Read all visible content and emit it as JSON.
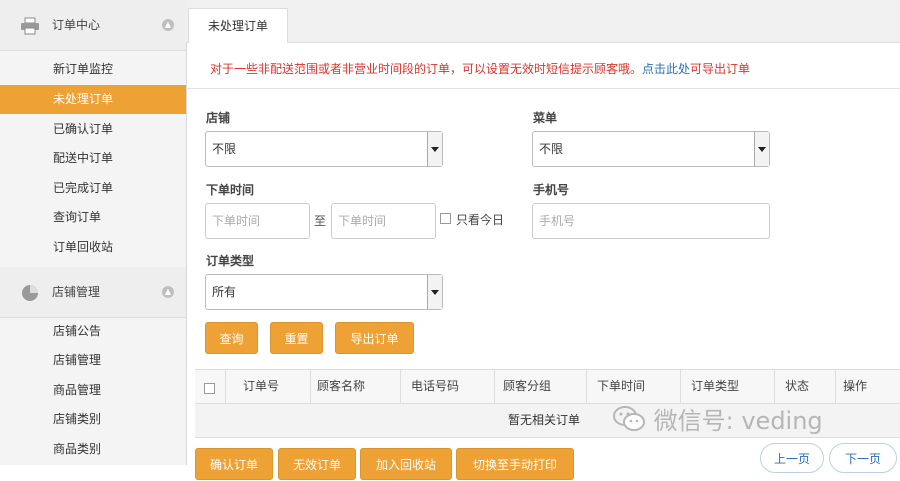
{
  "sidebar": {
    "sections": [
      {
        "label": "订单中心",
        "icon": "printer-icon",
        "toggle_icon": "collapse-up-icon",
        "items": [
          "新订单监控",
          "未处理订单",
          "已确认订单",
          "配送中订单",
          "已完成订单",
          "查询订单",
          "订单回收站"
        ],
        "active_index": 1
      },
      {
        "label": "店铺管理",
        "icon": "pie-chart-icon",
        "toggle_icon": "collapse-up-icon",
        "items": [
          "店铺公告",
          "店铺管理",
          "商品管理",
          "店铺类别",
          "商品类别"
        ]
      }
    ]
  },
  "tabs": [
    {
      "label": "未处理订单",
      "active": true
    }
  ],
  "notice": {
    "text_before": "对于一些非配送范围或者非营业时间段的订单，可以设置无效时短信提示顾客哦。",
    "link": "点击此处",
    "text_after": "可导出订单"
  },
  "filters": {
    "store_label": "店铺",
    "store_value": "不限",
    "menu_label": "菜单",
    "menu_value": "不限",
    "time_label": "下单时间",
    "time_from_placeholder": "下单时间",
    "time_sep": "至",
    "time_to_placeholder": "下单时间",
    "today_label": "只看今日",
    "phone_label": "手机号",
    "phone_placeholder": "手机号",
    "type_label": "订单类型",
    "type_value": "所有"
  },
  "buttons": {
    "query": "查询",
    "reset": "重置",
    "export": "导出订单"
  },
  "table": {
    "headers": [
      "订单号",
      "顾客名称",
      "电话号码",
      "顾客分组",
      "下单时间",
      "订单类型",
      "状态",
      "操作"
    ],
    "empty_text": "暂无相关订单"
  },
  "bottom_buttons": [
    "确认订单",
    "无效订单",
    "加入回收站",
    "切换至手动打印"
  ],
  "pagination": {
    "prev": "上一页",
    "next": "下一页"
  },
  "watermark": "微信号: veding",
  "colors": {
    "accent": "#eea236",
    "notice_red": "#d9342b",
    "link_blue": "#2a6fb8"
  }
}
